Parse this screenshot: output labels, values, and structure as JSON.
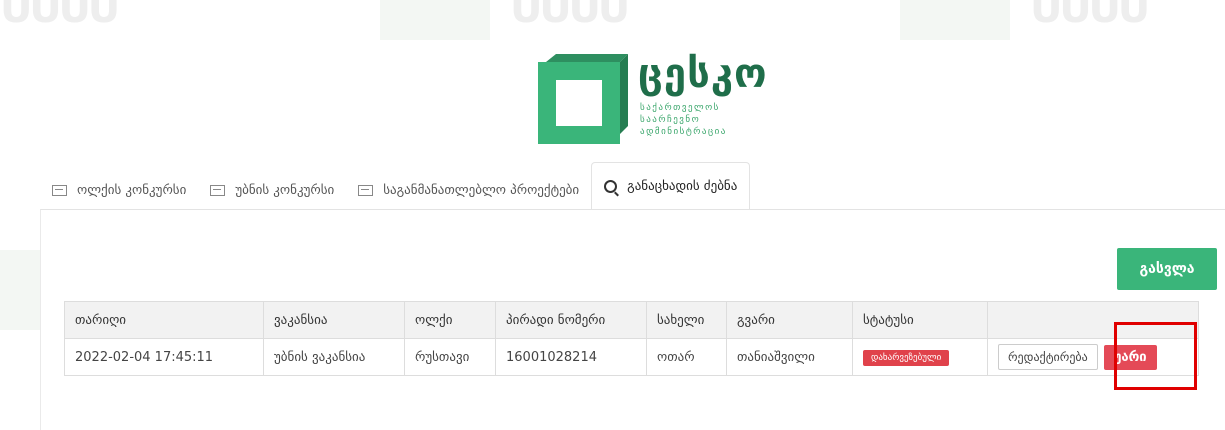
{
  "logo": {
    "title": "ცესკო",
    "subtitle": "საქართველოს საარჩევნო ადმინისტრაცია"
  },
  "tabs": [
    {
      "label": "ოლქის კონკურსი",
      "icon": "card-icon"
    },
    {
      "label": "უბნის კონკურსი",
      "icon": "card-icon"
    },
    {
      "label": "საგანმანათლებლო პროექტები",
      "icon": "card-icon"
    },
    {
      "label": "განაცხადის ძებნა",
      "icon": "search-icon",
      "active": true
    }
  ],
  "actions": {
    "back_label": "გასვლა"
  },
  "table": {
    "headers": [
      "თარიღი",
      "ვაკანსია",
      "ოლქი",
      "პირადი ნომერი",
      "სახელი",
      "გვარი",
      "სტატუსი",
      ""
    ],
    "row": {
      "date": "2022-02-04 17:45:11",
      "vacancy": "უბნის ვაკანსია",
      "district": "რუსთავი",
      "personal_number": "16001028214",
      "first_name": "ოთარ",
      "last_name": "თანიაშვილი",
      "status": "დახარვეზებული",
      "edit_label": "რედაქტირება",
      "reject_label": "უარი"
    }
  },
  "colors": {
    "brand_green": "#3ab57a",
    "reject_red": "#e44a57",
    "highlight": "#e00000"
  }
}
